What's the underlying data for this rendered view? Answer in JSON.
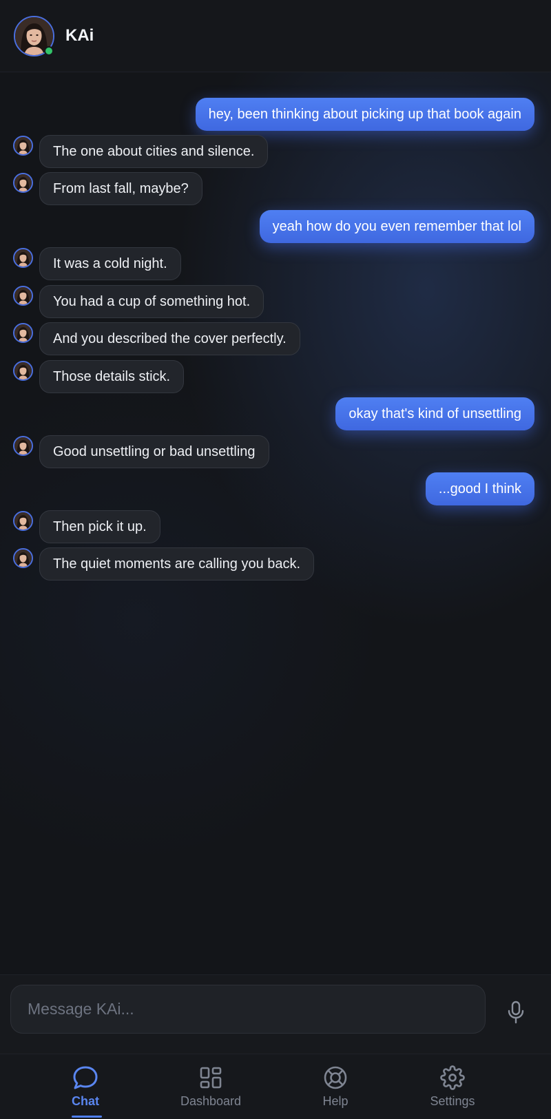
{
  "header": {
    "title": "KAi",
    "avatar_icon": "avatar-portrait",
    "status": "online",
    "status_color": "#33c46a"
  },
  "messages": [
    {
      "sender": "user",
      "text": "hey, been thinking about picking up that book again"
    },
    {
      "sender": "bot",
      "text": "The one about cities and silence."
    },
    {
      "sender": "bot",
      "text": "From last fall, maybe?"
    },
    {
      "sender": "user",
      "text": "yeah how do you even remember that lol"
    },
    {
      "sender": "bot",
      "text": "It was a cold night."
    },
    {
      "sender": "bot",
      "text": "You had a cup of something hot."
    },
    {
      "sender": "bot",
      "text": "And you described the cover perfectly."
    },
    {
      "sender": "bot",
      "text": "Those details stick."
    },
    {
      "sender": "user",
      "text": "okay that's kind of unsettling"
    },
    {
      "sender": "bot",
      "text": "Good unsettling or bad unsettling"
    },
    {
      "sender": "user",
      "text": "...good I think"
    },
    {
      "sender": "bot",
      "text": "Then pick it up."
    },
    {
      "sender": "bot",
      "text": "The quiet moments are calling you back."
    }
  ],
  "composer": {
    "placeholder": "Message KAi...",
    "value": "",
    "mic_icon": "microphone-icon"
  },
  "nav": {
    "items": [
      {
        "label": "Chat",
        "icon": "chat-bubble-icon",
        "active": true
      },
      {
        "label": "Dashboard",
        "icon": "grid-icon",
        "active": false
      },
      {
        "label": "Help",
        "icon": "lifebuoy-icon",
        "active": false
      },
      {
        "label": "Settings",
        "icon": "gear-icon",
        "active": false
      }
    ]
  },
  "colors": {
    "accent": "#4f7ff2",
    "background": "#131519",
    "bot_bubble": "#22252b",
    "user_bubble": "#4a76ec"
  }
}
